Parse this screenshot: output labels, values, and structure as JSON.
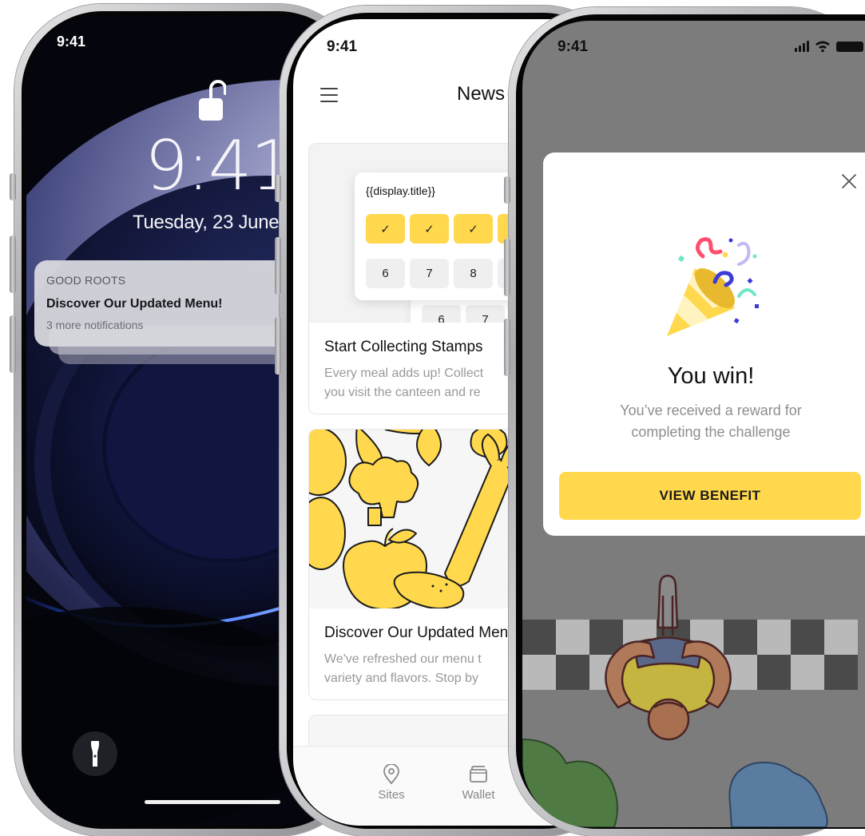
{
  "lock_screen": {
    "status_time": "9:41",
    "clock": "9:41",
    "date": "Tuesday, 23 June",
    "notification": {
      "app": "GOOD ROOTS",
      "title": "Discover Our Updated Menu!",
      "subtitle": "3 more notifications"
    },
    "torch_icon": "flashlight-icon",
    "lock_icon": "unlocked-padlock-icon"
  },
  "news_screen": {
    "status_time": "9:41",
    "header_title": "News",
    "menu_icon": "hamburger-menu-icon",
    "cards": [
      {
        "title": "Start Collecting Stamps",
        "desc_line1": "Every meal adds up! Collect",
        "desc_line2": "you visit the canteen and re",
        "stamp_card": {
          "title": "{{display.title}}",
          "checked": [
            "✓",
            "✓",
            "✓"
          ],
          "numbers": [
            "6",
            "7",
            "8"
          ],
          "back_numbers": [
            "6",
            "7"
          ]
        }
      },
      {
        "title": "Discover Our Updated Menu",
        "desc_line1": "We've refreshed our menu t",
        "desc_line2": "variety and flavors. Stop by"
      }
    ],
    "tabs": [
      {
        "label": "Sites",
        "icon": "map-pin-icon"
      },
      {
        "label": "Wallet",
        "icon": "wallet-icon"
      }
    ]
  },
  "reward_screen": {
    "status_time": "9:41",
    "modal": {
      "title": "You win!",
      "subtitle": "You’ve received a reward for completing the challenge",
      "button": "VIEW BENEFIT",
      "close_icon": "close-icon",
      "illustration_icon": "party-popper-icon"
    },
    "colors": {
      "accent": "#FFD84D",
      "overlay": "#7C7C7C"
    }
  }
}
